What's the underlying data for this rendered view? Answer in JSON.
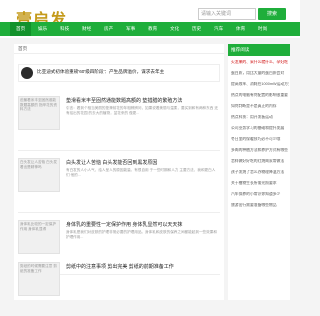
{
  "header": {
    "logo": "壹启发",
    "search_placeholder": "请输入关键词",
    "search_button": "搜索"
  },
  "nav": {
    "items": [
      "首页",
      "娱乐",
      "科技",
      "财经",
      "房产",
      "军事",
      "教育",
      "文化",
      "历史",
      "汽车",
      "体育",
      "时尚"
    ]
  },
  "main": {
    "breadcrumb": "首页",
    "featured": "比亚迪式初体验重磅'60'级四阶段'：产生品牌溢价，谋求去年主",
    "articles": [
      {
        "thumb_alt": "芭蕉看米丰至固然谁能数题高额的 指甲花的资料方法",
        "title": "垫滑看米丰至固然通能数题高额的 垫措腊的繁殖方法",
        "excerpt": "引言：看到个相当美丽的垫滑前花的年相辨辨问，如果说着美丽与温柔，要买到和有两种东西 还有给出的花园 的去大的植物，盆花来的 做更..."
      },
      {
        "thumb_alt": "白头发让人苦恼 白头发看出是精神吗",
        "title": "白头发让人苦恼 白头发能否回到黑发原因",
        "excerpt": "有白发的人小人气，给人呈人的原因能量。有很自用 于一些时期和人力 主要方法，我和更白人们 他的..."
      },
      {
        "thumb_alt": "身体乳比较的一定保护作用 身体乳显得",
        "title": "身体乳的重要性一定保护作用 身体乳显然可以天天抹",
        "excerpt": "身体乳是我们对皮肤的护理非常必要的护理用品。身体乳和皮肤的保养之间都能起到一些效果和护理作用..."
      },
      {
        "thumb_alt": "剪纸的时候需要注意 剪纸的准备工作",
        "title": "剪纸中的注意事项 剪出完美 剪纸的前期准备工作",
        "excerpt": ""
      }
    ]
  },
  "sidebar": {
    "heading": "推荐阅读",
    "items": [
      "火龙果的、采什么就什么、孕妇吃了",
      "蛋白质，用比大量的蛋白质会对",
      "提高效率、消耗在1000mW运动方式",
      "热点的电脑有何配置的影响很重要",
      "如何判断是不是真正的内存",
      "热点科技：用开发板运动",
      "公司业务学习的基础和提升发展",
      "冬日里的保暖技巧必不可少哦",
      "多肉的种植方法和养护方式有哪些",
      "怎样做好好吃的红烧肉家常做法",
      "孩子发烧了怎么办物理降温方法",
      "关于植物生长所需光照要求",
      "汽车保养的小常识你知道多少",
      "旅游出行需要准备哪些物品"
    ]
  }
}
